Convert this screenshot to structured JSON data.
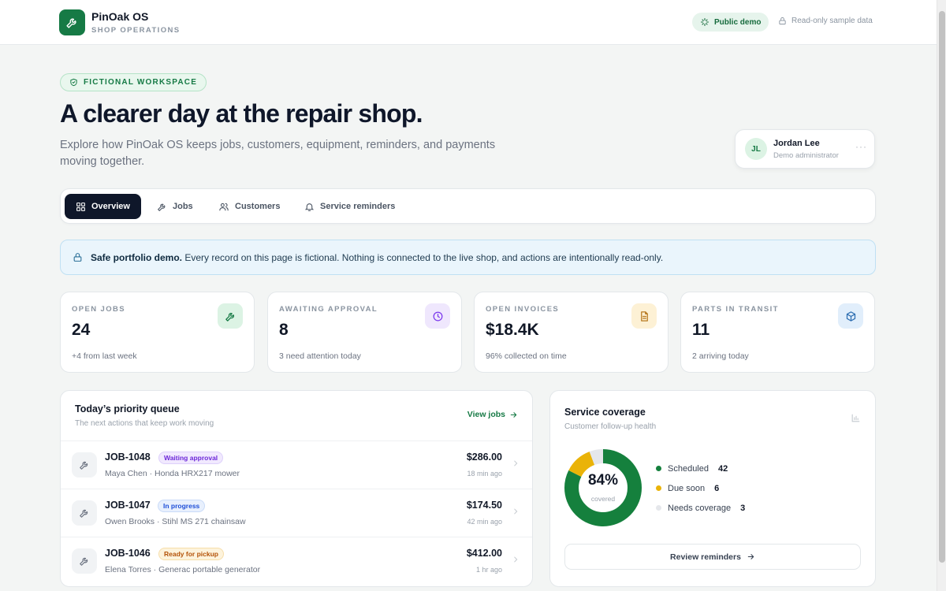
{
  "header": {
    "brand_name": "PinOak OS",
    "brand_sub": "SHOP OPERATIONS",
    "demo_pill": "Public demo",
    "readonly_label": "Read-only sample data"
  },
  "hero": {
    "badge": "FICTIONAL WORKSPACE",
    "title": "A clearer day at the repair shop.",
    "subtitle": "Explore how PinOak OS keeps jobs, customers, equipment, reminders, and payments moving together."
  },
  "user": {
    "initials": "JL",
    "name": "Jordan Lee",
    "role": "Demo administrator",
    "more": "···"
  },
  "tabs": [
    {
      "label": "Overview",
      "icon": "grid-icon"
    },
    {
      "label": "Jobs",
      "icon": "wrench-icon"
    },
    {
      "label": "Customers",
      "icon": "users-icon"
    },
    {
      "label": "Service reminders",
      "icon": "bell-icon"
    }
  ],
  "notice": {
    "strong": "Safe portfolio demo.",
    "text": "Every record on this page is fictional. Nothing is connected to the live shop, and actions are intentionally read-only."
  },
  "stats": [
    {
      "label": "OPEN JOBS",
      "value": "24",
      "note": "+4 from last week",
      "icon": "wrench-icon",
      "color": "#167a45",
      "bg": "#dcf3e4"
    },
    {
      "label": "AWAITING APPROVAL",
      "value": "8",
      "note": "3 need attention today",
      "icon": "clock-icon",
      "color": "#7c3aed",
      "bg": "#efe7fd"
    },
    {
      "label": "OPEN INVOICES",
      "value": "$18.4K",
      "note": "96% collected on time",
      "icon": "document-icon",
      "color": "#b7791f",
      "bg": "#fdf1d5"
    },
    {
      "label": "PARTS IN TRANSIT",
      "value": "11",
      "note": "2 arriving today",
      "icon": "package-icon",
      "color": "#2b6cb0",
      "bg": "#e1eefb"
    }
  ],
  "queue": {
    "title": "Today’s priority queue",
    "subtitle": "The next actions that keep work moving",
    "view_link": "View jobs",
    "rows": [
      {
        "id": "JOB-1048",
        "status": "Waiting approval",
        "status_color": "#6d28d9",
        "status_bg": "#f1e9fe",
        "status_border": "#ddd0fb",
        "desc": "Maya Chen · Honda HRX217 mower",
        "amount": "$286.00",
        "time": "18 min ago"
      },
      {
        "id": "JOB-1047",
        "status": "In progress",
        "status_color": "#1d4ed8",
        "status_bg": "#e8f0fd",
        "status_border": "#c9dbf8",
        "desc": "Owen Brooks · Stihl MS 271 chainsaw",
        "amount": "$174.50",
        "time": "42 min ago"
      },
      {
        "id": "JOB-1046",
        "status": "Ready for pickup",
        "status_color": "#b45309",
        "status_bg": "#fdf3dc",
        "status_border": "#f6deaa",
        "desc": "Elena Torres · Generac portable generator",
        "amount": "$412.00",
        "time": "1 hr ago"
      }
    ]
  },
  "coverage": {
    "title": "Service coverage",
    "subtitle": "Customer follow-up health",
    "percent": "84%",
    "caption": "covered",
    "button": "Review reminders"
  },
  "chart_data": {
    "type": "pie",
    "categories": [
      "Scheduled",
      "Due soon",
      "Needs coverage"
    ],
    "values": [
      42,
      6,
      3
    ],
    "colors": [
      "#15803d",
      "#eab308",
      "#e5e7eb"
    ],
    "title": "Service coverage"
  }
}
